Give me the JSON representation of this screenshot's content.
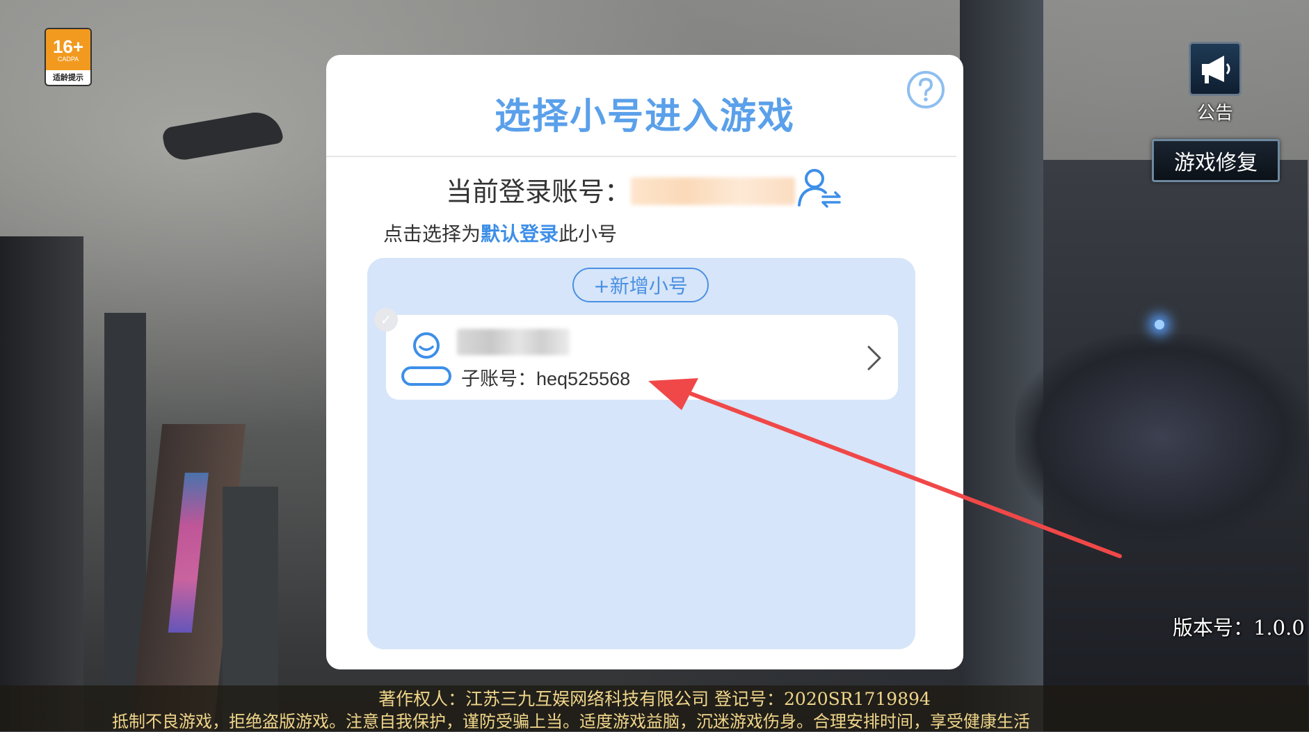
{
  "age_badge": {
    "age": "16+",
    "org": "CADPA",
    "tip": "适龄提示"
  },
  "notice": {
    "label": "公告",
    "icon": "megaphone-icon"
  },
  "repair_button": {
    "label": "游戏修复"
  },
  "version": {
    "text": "版本号：1.0.0"
  },
  "footer": {
    "line1": "著作权人：江苏三九互娱网络科技有限公司  登记号：2020SR1719894",
    "line2": "抵制不良游戏，拒绝盗版游戏。注意自我保护，谨防受骗上当。适度游戏益脑，沉迷游戏伤身。合理安排时间，享受健康生活"
  },
  "dialog": {
    "title": "选择小号进入游戏",
    "help_icon": "question-icon",
    "current_account_label": "当前登录账号：",
    "switch_icon": "switch-user-icon",
    "hint_prefix": "点击选择为",
    "hint_emphasis": "默认登录",
    "hint_suffix": "此小号",
    "add_button": "+新增小号",
    "accounts": [
      {
        "sub_label": "子账号：",
        "sub_id": "heq525568",
        "avatar_icon": "user-avatar-icon",
        "selected": false
      }
    ]
  },
  "colors": {
    "accent": "#5aa0ea",
    "panel": "#d6e5f9",
    "arrow": "#f04848"
  }
}
